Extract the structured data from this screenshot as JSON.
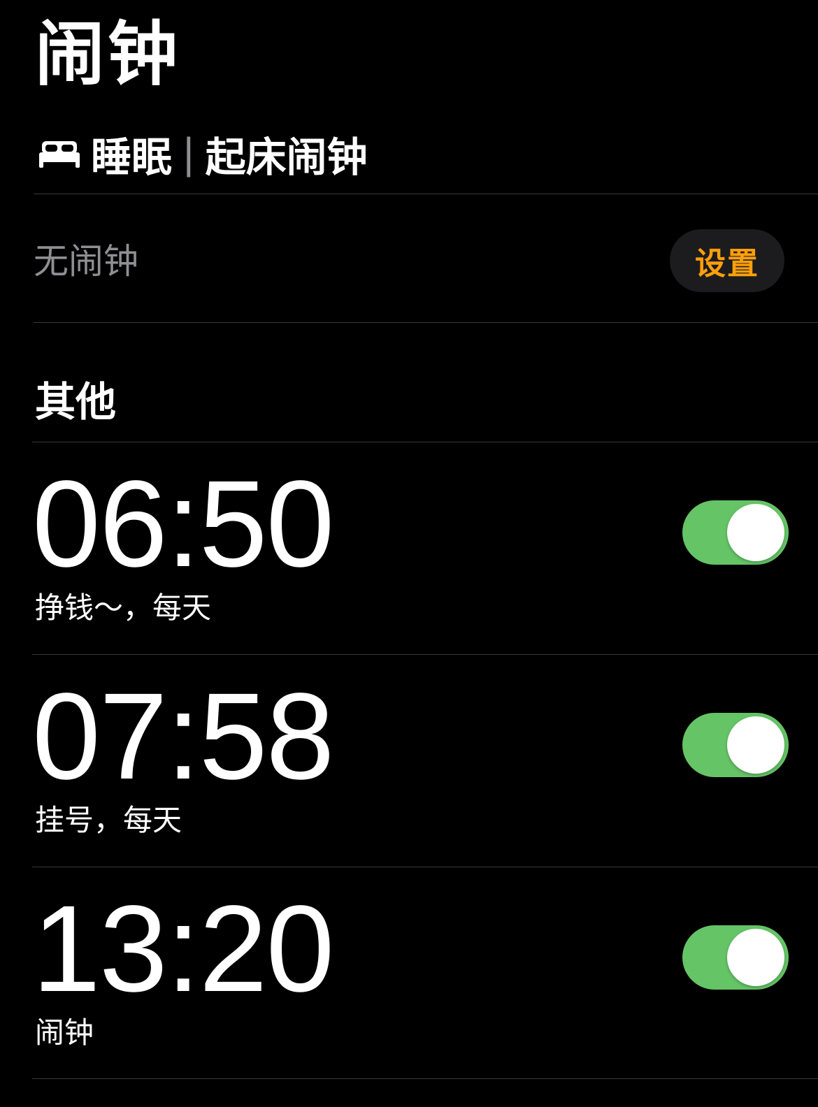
{
  "header": {
    "title": "闹钟"
  },
  "sleep": {
    "icon": "bed-icon",
    "label": "睡眠",
    "separator": "|",
    "sublabel": "起床闹钟",
    "status": "无闹钟",
    "set_label": "设置",
    "set_color": "#ff9f0a"
  },
  "other": {
    "title": "其他",
    "alarms": [
      {
        "time": "06:50",
        "label": "挣钱～，每天",
        "enabled": true
      },
      {
        "time": "07:58",
        "label": "挂号，每天",
        "enabled": true
      },
      {
        "time": "13:20",
        "label": "闹钟",
        "enabled": true
      }
    ]
  },
  "colors": {
    "toggle_on": "#65c466",
    "background": "#000000",
    "secondary_text": "#8e8e93"
  }
}
